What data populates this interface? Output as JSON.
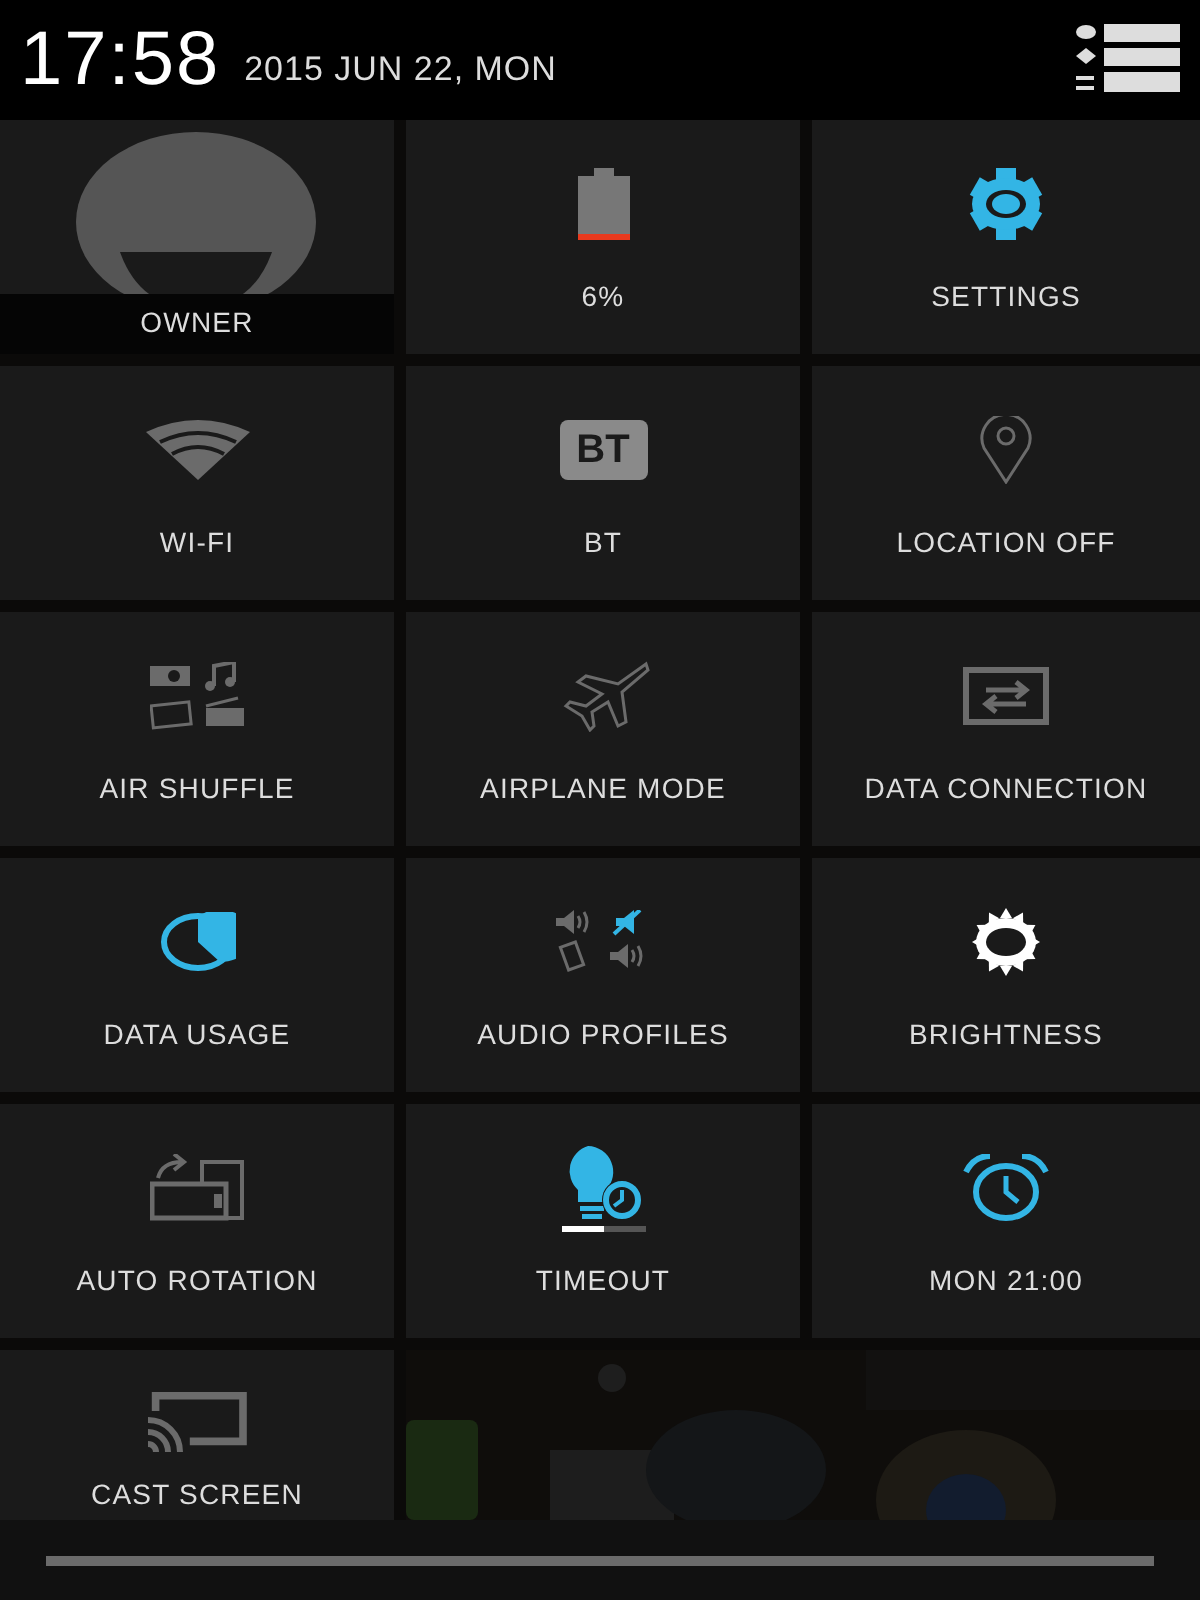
{
  "status": {
    "time": "17:58",
    "date": "2015 JUN 22, MON"
  },
  "tiles": [
    {
      "kind": "avatar",
      "label": "OWNER",
      "on": false
    },
    {
      "kind": "battery",
      "label": "6%",
      "on": false
    },
    {
      "kind": "settings",
      "label": "SETTINGS",
      "on": true
    },
    {
      "kind": "wifi",
      "label": "WI-FI",
      "on": false
    },
    {
      "kind": "bt",
      "label": "BT",
      "icon_text": "BT",
      "on": false
    },
    {
      "kind": "location",
      "label": "LOCATION OFF",
      "on": false
    },
    {
      "kind": "air-shuffle",
      "label": "AIR SHUFFLE",
      "on": false
    },
    {
      "kind": "airplane",
      "label": "AIRPLANE MODE",
      "on": false
    },
    {
      "kind": "data-connection",
      "label": "DATA CONNECTION",
      "on": false
    },
    {
      "kind": "data-usage",
      "label": "DATA USAGE",
      "on": true
    },
    {
      "kind": "audio",
      "label": "AUDIO PROFILES",
      "on": false
    },
    {
      "kind": "brightness",
      "label": "BRIGHTNESS",
      "on": false
    },
    {
      "kind": "rotation",
      "label": "AUTO ROTATION",
      "on": false
    },
    {
      "kind": "timeout",
      "label": "TIMEOUT",
      "on": true,
      "level": 0.5
    },
    {
      "kind": "alarm",
      "label": "MON 21:00",
      "on": true
    },
    {
      "kind": "cast",
      "label": "CAST SCREEN",
      "on": false
    }
  ]
}
